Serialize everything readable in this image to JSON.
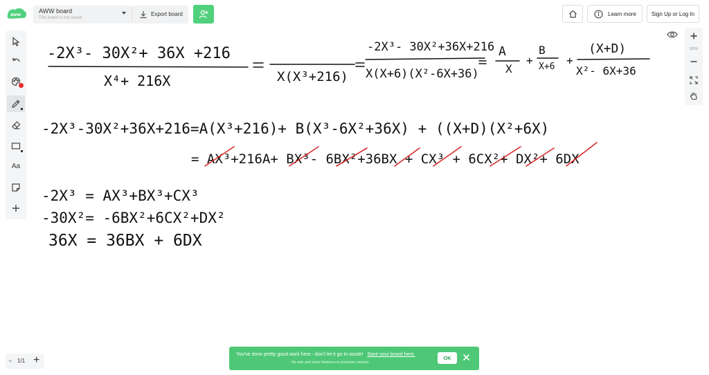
{
  "header": {
    "board_name": "AWW board",
    "board_status": "This board is not saved",
    "export_label": "Export board",
    "learn_more_label": "Learn more",
    "signup_label": "Sign Up or Log In"
  },
  "toolbar": {
    "tools": [
      "pointer-icon",
      "undo-icon",
      "color-palette-icon",
      "pencil-icon",
      "eraser-icon",
      "rectangle-icon",
      "text-icon",
      "sticky-note-icon",
      "add-icon"
    ],
    "text_tool_label": "Aa",
    "active_tool": "pencil",
    "active_color": "#e32b2b"
  },
  "zoom": {
    "level": "100%"
  },
  "pages": {
    "indicator": "1/1"
  },
  "toast": {
    "message": "You've done pretty good work here - don't let it go to waste!",
    "link": "Save your board here.",
    "sub": "No ads and more features in premium version",
    "ok_label": "OK"
  },
  "whiteboard": {
    "lines": [
      "(-2x^3 - 30x^2 + 36x + 216)/(x^4 + 216x) = (-2x^3 - 30x^2 + 36x + 216)/(x(x^3+216)) = (-2x^3 - 30x^2 + 36x + 216)/(x(x+6)(x^2-6x+36)) = A/x + B/(x+6) + (Cx+D)/(x^2-6x+36)",
      "-2x^3 - 30x^2 + 36x + 216 = A(x^3+216) + B(x^3-6x^2+36x) + (Cx+D)(x^2+6x)",
      "= Ax^3 + 216A + Bx^3 - 6Bx^2 + 36Bx + Cx^3 + 6Cx^2 + Dx^2 + 6Dx",
      "-2x^3 = Ax^3 + Bx^3 + Cx^3",
      "-30x^2 = -6Bx^2 + 6Cx^2 + Dx^2",
      "36x = 36Bx + 6Dx"
    ],
    "ink_color": "#111111",
    "annotation_color": "#d62828"
  },
  "colors": {
    "brand_green": "#52d17d",
    "toast_green": "#4ec876",
    "toolbar_bg": "#f4f5f6"
  }
}
